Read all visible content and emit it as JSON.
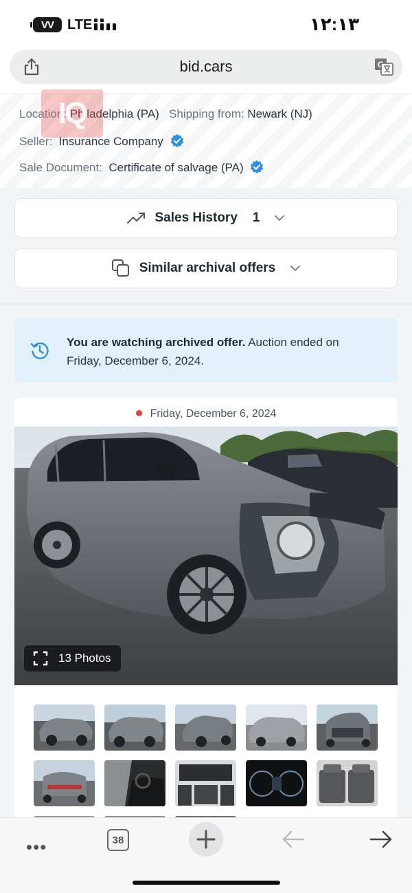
{
  "status_bar": {
    "battery": "VV",
    "network": "LTE",
    "time": "۱۲:۱۳"
  },
  "browser": {
    "url": "bid.cars"
  },
  "listing": {
    "location_label": "Location:",
    "location_value": "Philadelphia (PA)",
    "shipping_label": "Shipping from:",
    "shipping_value": "Newark (NJ)",
    "seller_label": "Seller:",
    "seller_value": "Insurance Company",
    "document_label": "Sale Document:",
    "document_value": "Certificate of salvage (PA)"
  },
  "watermark": "IQ",
  "accordions": {
    "sales_history_label": "Sales History",
    "sales_history_count": "1",
    "similar_label": "Similar archival offers"
  },
  "notice": {
    "bold": "You are watching archived offer.",
    "rest": " Auction ended on Friday, December 6, 2024."
  },
  "card": {
    "date": "Friday, December 6, 2024",
    "photos_label": "13 Photos"
  },
  "toolbar": {
    "tabs_count": "38"
  },
  "colors": {
    "verified": "#2f8fe0",
    "notice_bg": "#e3f1fb",
    "dot": "#e53e3e"
  },
  "icons": [
    "share-icon",
    "translate-icon",
    "verified-icon",
    "trend-icon",
    "copy-icon",
    "chevron-down-icon",
    "history-icon",
    "expand-icon",
    "more-icon",
    "plus-icon",
    "back-arrow-icon",
    "forward-arrow-icon"
  ]
}
